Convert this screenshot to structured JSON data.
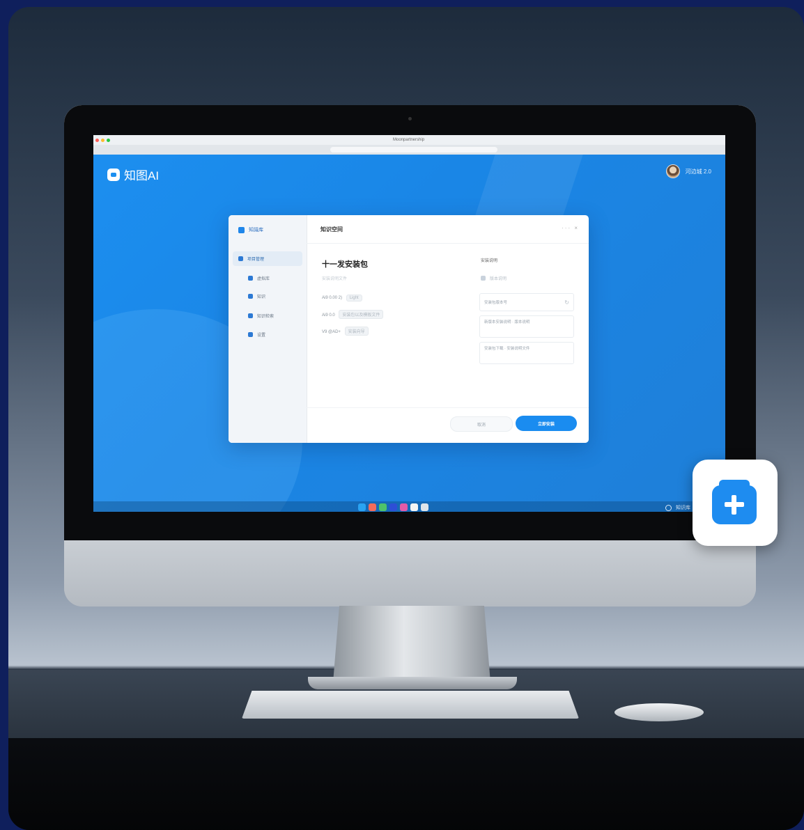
{
  "app": {
    "name": "知图AI",
    "user_label": "河边城 2.0"
  },
  "browser": {
    "title": "Moonpartnership"
  },
  "dialog": {
    "sidebar_header": "知識库",
    "sidebar_items": [
      {
        "label": "项目管理"
      },
      {
        "label": "虚拟库"
      },
      {
        "label": "知识"
      },
      {
        "label": "知识检索"
      },
      {
        "label": "设置"
      }
    ],
    "title": "知识空间",
    "controls": "··· ×",
    "package_title": "十一发安装包",
    "package_sub": "安装说明文件",
    "rows": [
      {
        "label": "Ai9 0.00 2)",
        "chip": "Light"
      },
      {
        "label": "Ai9 0.0",
        "chip": "安装包以及模板文件"
      },
      {
        "label": "V9 @AD+",
        "chip": "安装向导"
      }
    ],
    "right_title": "安装说明",
    "right_sub": "版本说明",
    "right_boxes": [
      "安装包版本号",
      "新版本安装说明 · 版本说明",
      "安装包下载 · 安装说明文件"
    ],
    "cancel_label": "取消",
    "ok_label": "立即安装"
  },
  "dock": {
    "right_label": "知识库"
  },
  "colors": {
    "accent": "#1a8cf0",
    "screen": "#1c8ff0"
  }
}
